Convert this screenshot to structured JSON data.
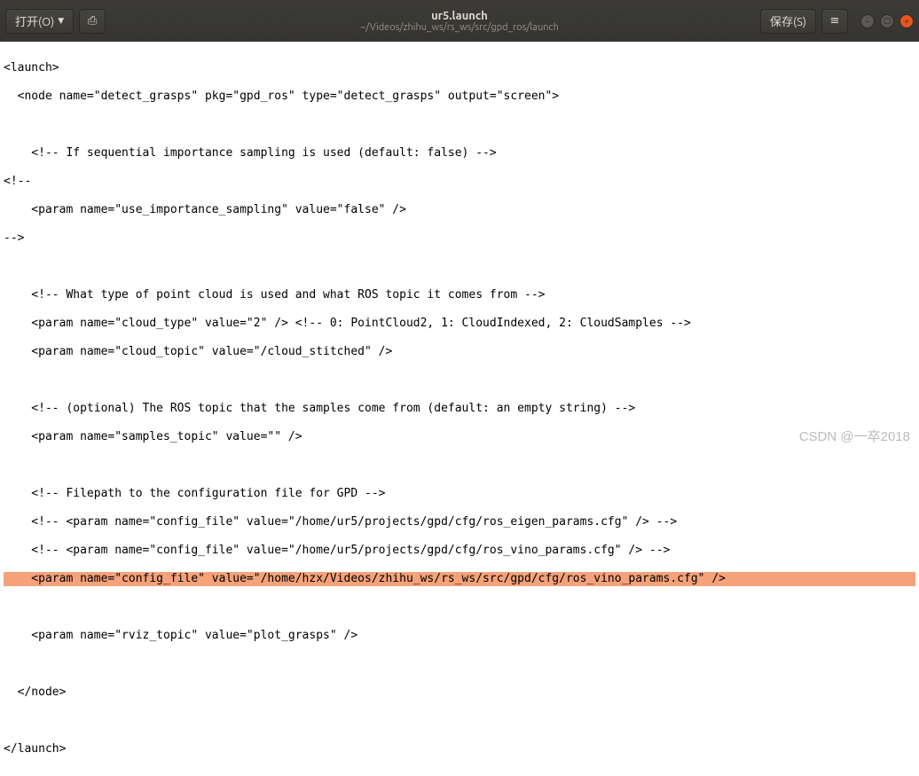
{
  "header": {
    "open_label": "打开(O)",
    "title": "ur5.launch",
    "path": "~/Videos/zhihu_ws/rs_ws/src/gpd_ros/launch",
    "save_label": "保存(S)"
  },
  "code": {
    "l1": "<launch>",
    "l2": "  <node name=\"detect_grasps\" pkg=\"gpd_ros\" type=\"detect_grasps\" output=\"screen\">",
    "l3": "",
    "l4": "    <!-- If sequential importance sampling is used (default: false) -->",
    "l5": "<!--",
    "l6": "    <param name=\"use_importance_sampling\" value=\"false\" />",
    "l7": "-->",
    "l8": "",
    "l9": "    <!-- What type of point cloud is used and what ROS topic it comes from -->",
    "l10": "    <param name=\"cloud_type\" value=\"2\" /> <!-- 0: PointCloud2, 1: CloudIndexed, 2: CloudSamples -->",
    "l11": "    <param name=\"cloud_topic\" value=\"/cloud_stitched\" />",
    "l12": "",
    "l13": "    <!-- (optional) The ROS topic that the samples come from (default: an empty string) -->",
    "l14": "    <param name=\"samples_topic\" value=\"\" />",
    "l15": "",
    "l16": "    <!-- Filepath to the configuration file for GPD -->",
    "l17": "    <!-- <param name=\"config_file\" value=\"/home/ur5/projects/gpd/cfg/ros_eigen_params.cfg\" /> -->",
    "l18": "    <!-- <param name=\"config_file\" value=\"/home/ur5/projects/gpd/cfg/ros_vino_params.cfg\" /> -->",
    "l19": "    <param name=\"config_file\" value=\"/home/hzx/Videos/zhihu_ws/rs_ws/src/gpd/cfg/ros_vino_params.cfg\" />",
    "l20": "",
    "l21": "    <param name=\"rviz_topic\" value=\"plot_grasps\" />",
    "l22": "",
    "l23": "  </node>",
    "l24": "",
    "l25": "</launch>"
  },
  "watermark": "CSDN @一卒2018"
}
